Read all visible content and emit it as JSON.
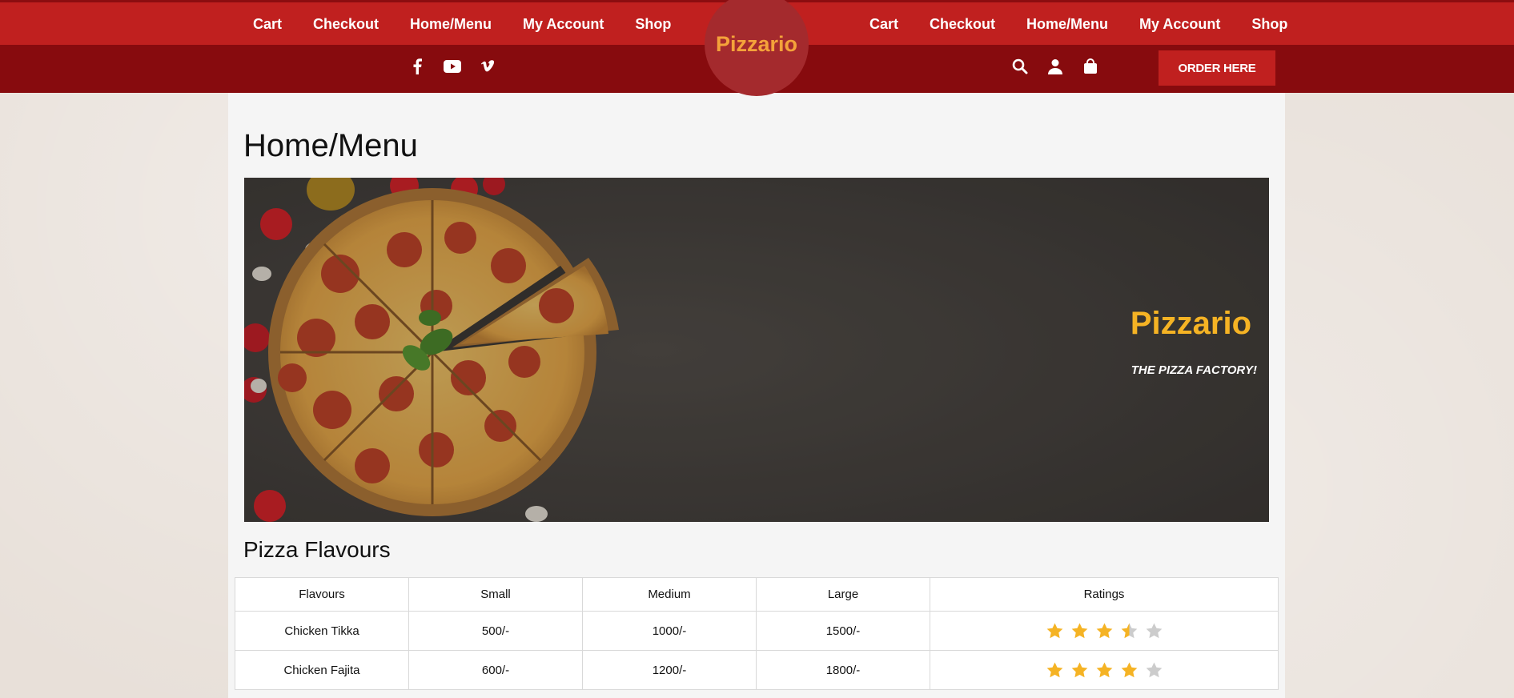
{
  "header": {
    "nav_left": [
      "Cart",
      "Checkout",
      "Home/Menu",
      "My Account",
      "Shop"
    ],
    "nav_right": [
      "Cart",
      "Checkout",
      "Home/Menu",
      "My Account",
      "Shop"
    ],
    "logo": "Pizzario",
    "social_icons": [
      "facebook-icon",
      "youtube-icon",
      "vimeo-icon"
    ],
    "utility_icons": [
      "search-icon",
      "user-icon",
      "shopping-bag-icon"
    ],
    "order_button": "ORDER HERE"
  },
  "colors": {
    "primary_red": "#c0201f",
    "dark_red": "#870b0e",
    "logo_text": "#f4a23a",
    "hero_title": "#f5b324",
    "price": "#e02424",
    "star": "#f5b324",
    "star_empty": "#cccccc"
  },
  "main": {
    "page_title": "Home/Menu",
    "hero": {
      "title": "Pizzario",
      "subtitle": "THE PIZZA FACTORY!"
    },
    "section_title": "Pizza Flavours",
    "table": {
      "headers": [
        "Flavours",
        "Small",
        "Medium",
        "Large",
        "Ratings"
      ],
      "rows": [
        {
          "flavour": "Chicken Tikka",
          "small": "500/-",
          "medium": "1000/-",
          "large": "1500/-",
          "rating": 3.5
        },
        {
          "flavour": "Chicken Fajita",
          "small": "600/-",
          "medium": "1200/-",
          "large": "1800/-",
          "rating": 4
        }
      ]
    }
  }
}
